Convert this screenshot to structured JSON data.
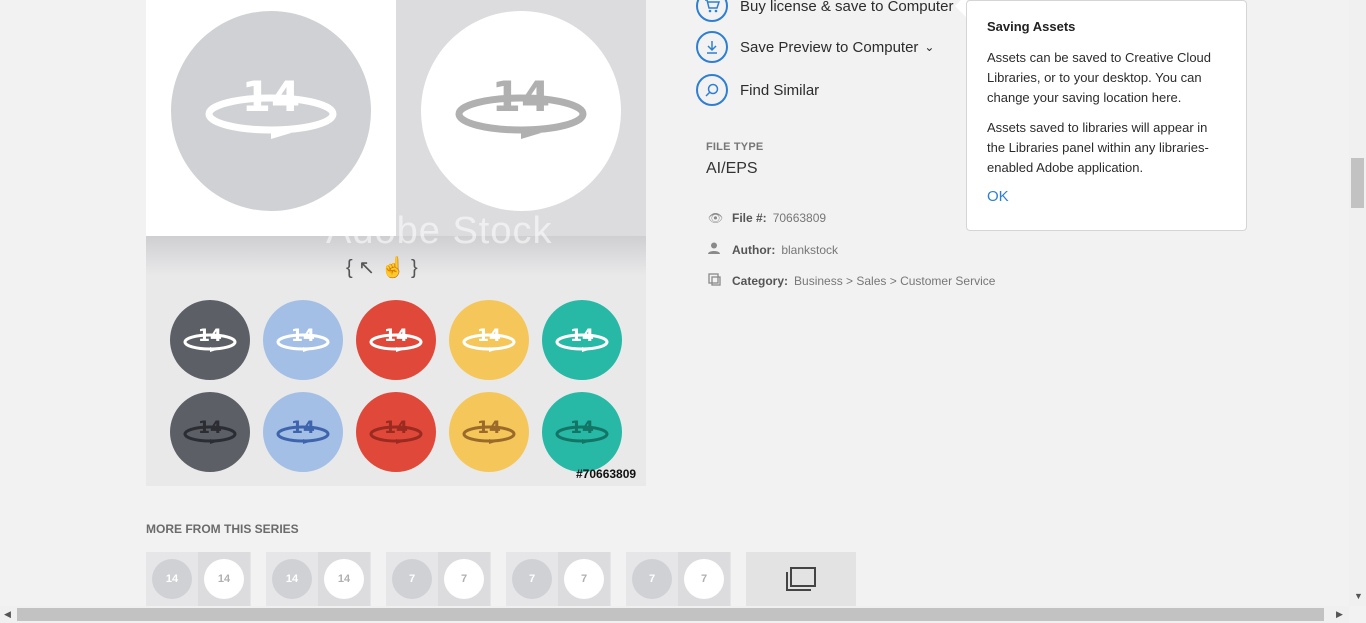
{
  "preview": {
    "watermark": "Adobe Stock",
    "file_number_label": "#70663809",
    "big_icon_text": "14",
    "row1_colors": [
      "#5c5f66",
      "#a3bfe6",
      "#e0493a",
      "#f5c75a",
      "#27b9a6"
    ],
    "row2_colors": [
      "#5c5f66",
      "#a3bfe6",
      "#e0493a",
      "#f5c75a",
      "#27b9a6"
    ],
    "row2_glyph_colors": [
      "#2b2d33",
      "#3e64ad",
      "#9b2a20",
      "#9b6a2a",
      "#137566"
    ]
  },
  "actions": {
    "buy_label": "Buy license & save to Computer",
    "save_preview_label": "Save Preview to Computer",
    "find_similar_label": "Find Similar"
  },
  "file_type": {
    "label": "FILE TYPE",
    "value": "AI/EPS"
  },
  "meta": {
    "file_label": "File #:",
    "file_value": "70663809",
    "author_label": "Author:",
    "author_value": "blankstock",
    "category_label": "Category:",
    "category_value": "Business > Sales > Customer Service"
  },
  "tooltip": {
    "title": "Saving Assets",
    "p1": "Assets can be saved to Creative Cloud Libraries, or to your desktop. You can change your saving location here.",
    "p2": "Assets saved to libraries will appear in the Libraries panel within any libraries-enabled Adobe application.",
    "ok_label": "OK"
  },
  "series": {
    "title": "MORE FROM THIS SERIES",
    "thumbs": [
      "14",
      "14",
      "7",
      "7",
      "7"
    ]
  },
  "icons": [
    "cart-icon",
    "download-icon",
    "search-icon",
    "eye-icon",
    "user-icon",
    "category-icon",
    "chevron-down-icon",
    "collection-icon"
  ]
}
